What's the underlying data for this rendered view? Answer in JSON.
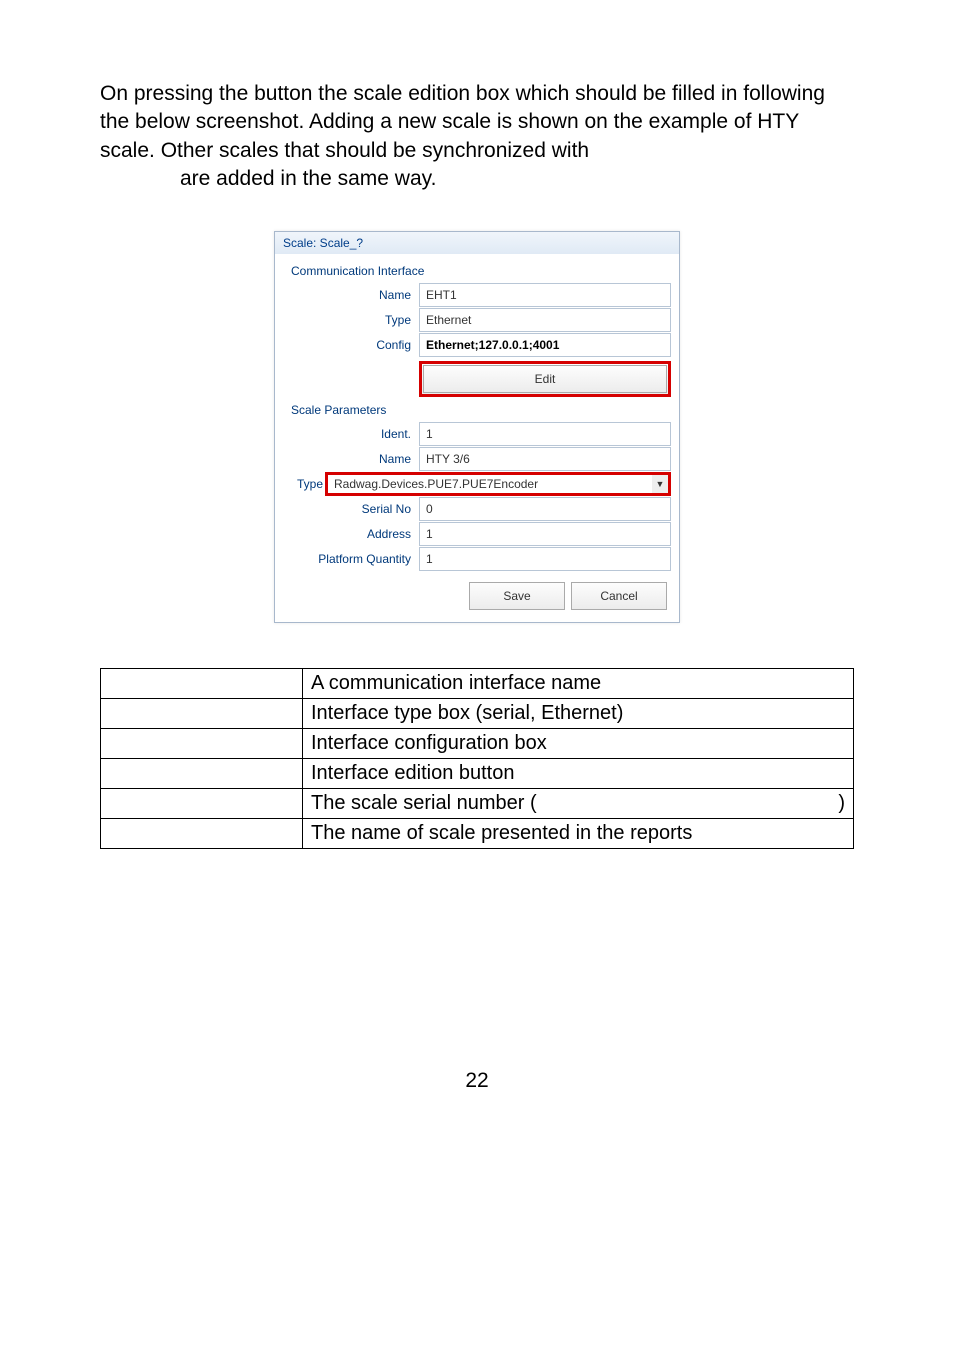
{
  "intro": {
    "line1": "On pressing the button the scale edition box which should be filled in following the below screenshot. Adding a new scale is shown on the example of HTY scale. Other scales that should be synchronized with",
    "line2": "are added in the same way."
  },
  "dialog": {
    "title": "Scale: Scale_?",
    "section1": "Communication Interface",
    "ci_name_label": "Name",
    "ci_name_value": "EHT1",
    "ci_type_label": "Type",
    "ci_type_value": "Ethernet",
    "ci_config_label": "Config",
    "ci_config_value": "Ethernet;127.0.0.1;4001",
    "edit_label": "Edit",
    "section2": "Scale Parameters",
    "sp_ident_label": "Ident.",
    "sp_ident_value": "1",
    "sp_name_label": "Name",
    "sp_name_value": "HTY 3/6",
    "sp_type_label": "Type",
    "sp_type_value": "Radwag.Devices.PUE7.PUE7Encoder",
    "sp_serial_label": "Serial No",
    "sp_serial_value": "0",
    "sp_address_label": "Address",
    "sp_address_value": "1",
    "sp_pq_label": "Platform Quantity",
    "sp_pq_value": "1",
    "save_label": "Save",
    "cancel_label": "Cancel"
  },
  "table": {
    "rows": [
      {
        "left": "",
        "right": "A communication interface name"
      },
      {
        "left": "",
        "right": "Interface type box (serial, Ethernet)"
      },
      {
        "left": "",
        "right": "Interface configuration box"
      },
      {
        "left": "",
        "right": "Interface edition button"
      },
      {
        "left": "",
        "right_pre": "The scale serial number (",
        "right_post": ")"
      },
      {
        "left": "",
        "right": "The name of scale presented in the reports"
      }
    ]
  },
  "page_number": "22"
}
